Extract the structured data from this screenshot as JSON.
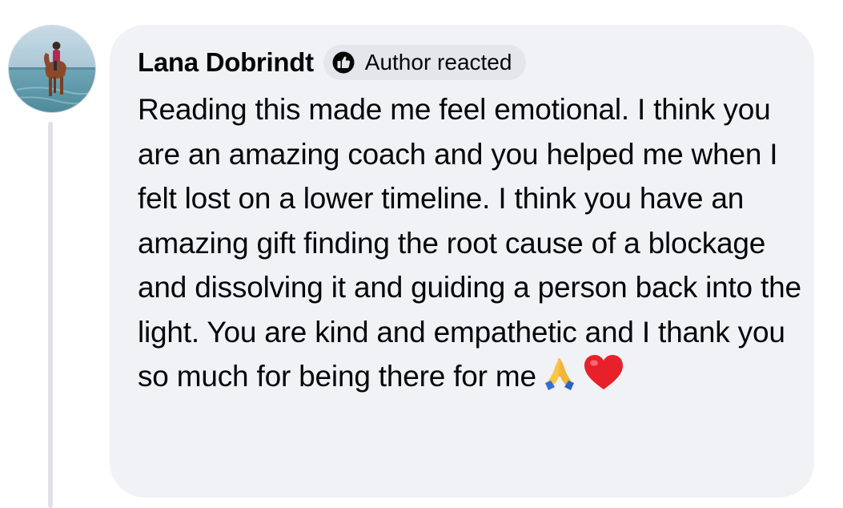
{
  "comment": {
    "author_name": "Lana Dobrindt",
    "badge_label": "Author reacted",
    "badge_icon": "author-reaction-icon",
    "text": "Reading this made me feel emotional. I think you are an amazing coach and you helped me when I felt lost on a lower timeline. I think you have an amazing gift finding the root cause of a blockage and dissolving it and guiding a person back into the light. You are kind and empathetic and I thank you so much for being there for me",
    "emojis": [
      "🙏",
      "❤️"
    ]
  },
  "colors": {
    "bubble_background": "#f0f2f5",
    "badge_background": "#e4e6eb",
    "thread_line": "#dfe3e8",
    "text": "#050505",
    "heart": "#e8202a"
  }
}
